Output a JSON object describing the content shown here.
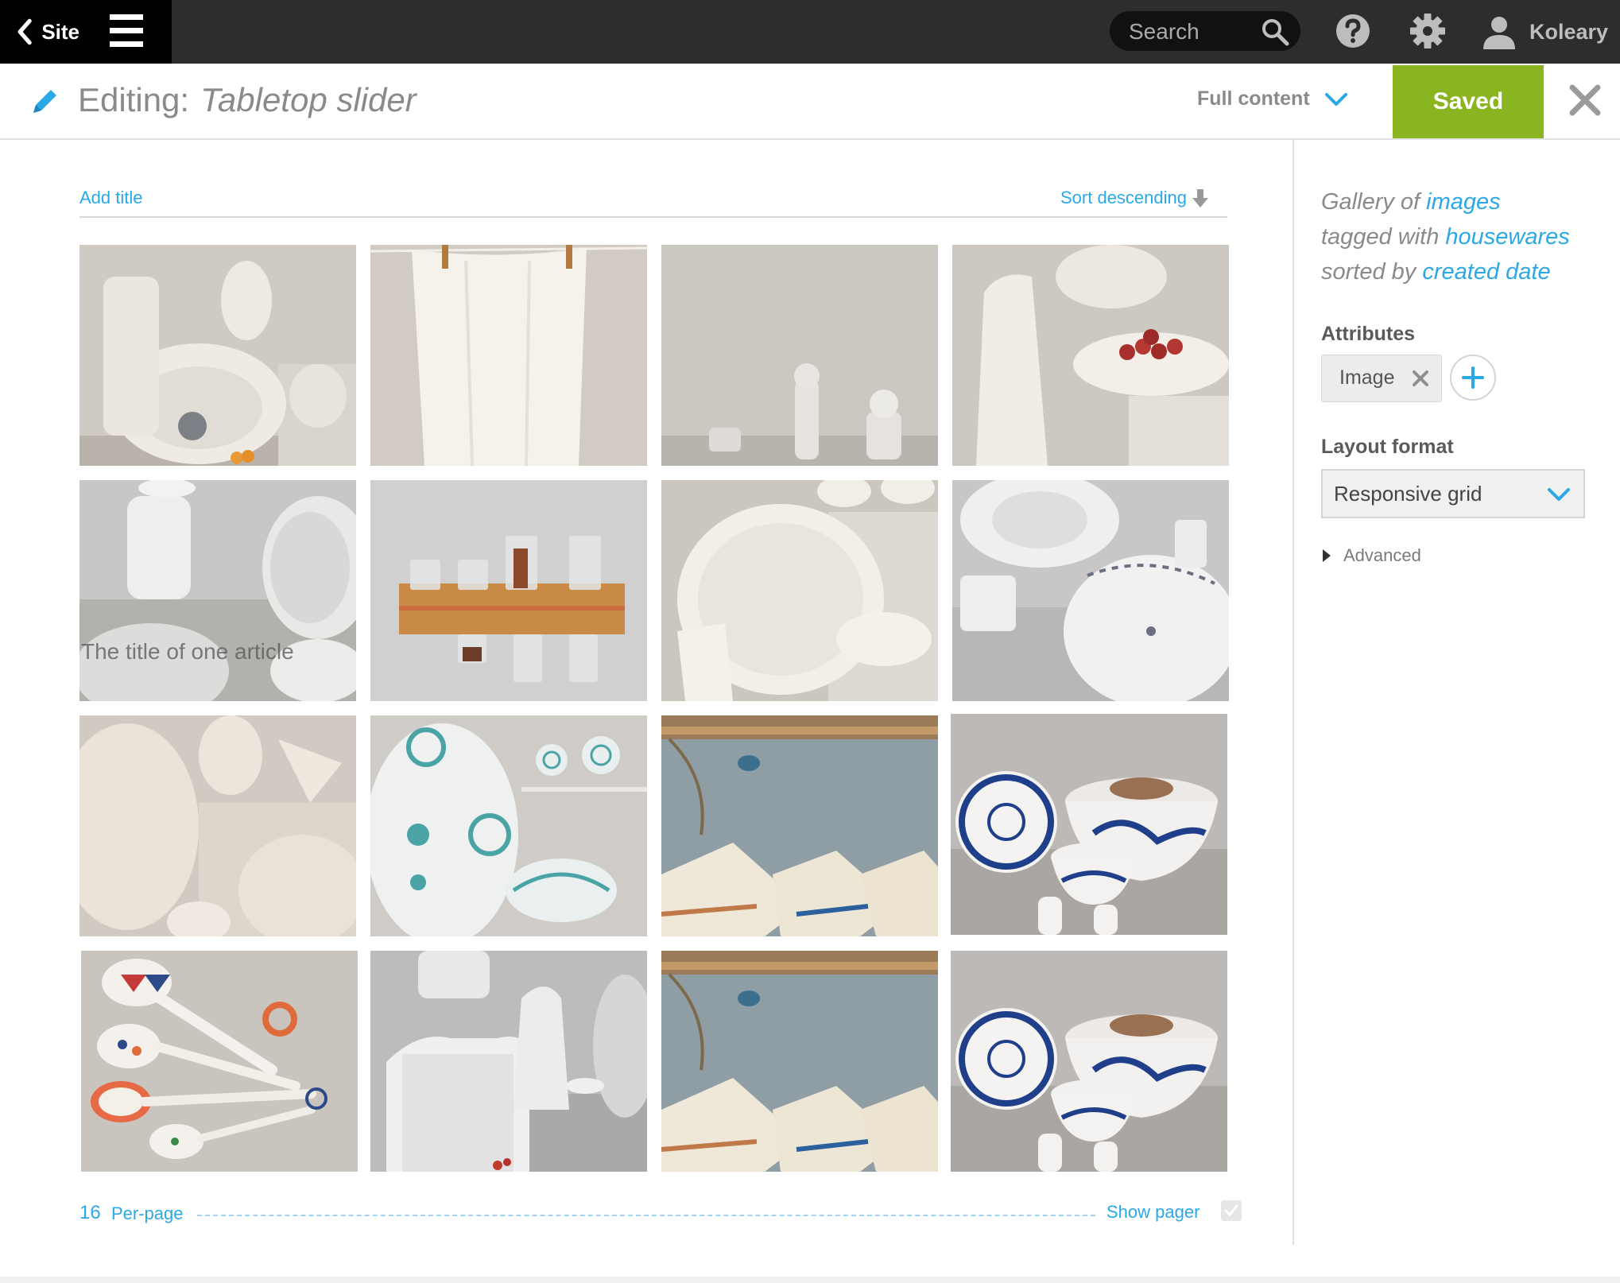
{
  "topbar": {
    "site_label": "Site",
    "search_placeholder": "Search",
    "user_name": "Koleary"
  },
  "editbar": {
    "editing_label": "Editing:",
    "item_name": "Tabletop slider",
    "content_mode": "Full content",
    "saved_label": "Saved"
  },
  "gallery": {
    "add_title": "Add title",
    "sort_label": "Sort descending",
    "overlay_text": "The title of one article",
    "per_page_count": "16",
    "per_page_label": "Per-page",
    "show_pager_label": "Show pager",
    "show_pager_checked": true,
    "tiles": [
      {
        "name": "tile-dishes-grey",
        "theme": "plates"
      },
      {
        "name": "tile-tea-towel",
        "theme": "towel"
      },
      {
        "name": "tile-salt-shakers",
        "theme": "shakers"
      },
      {
        "name": "tile-white-pitcher",
        "theme": "pitcher"
      },
      {
        "name": "tile-coffee-pot",
        "theme": "coffeepot"
      },
      {
        "name": "tile-spice-rack",
        "theme": "spicerack"
      },
      {
        "name": "tile-white-platter",
        "theme": "platter"
      },
      {
        "name": "tile-floral-plates",
        "theme": "floral"
      },
      {
        "name": "tile-lace-platter",
        "theme": "lace"
      },
      {
        "name": "tile-teal-platter",
        "theme": "teal"
      },
      {
        "name": "tile-pot-holders",
        "theme": "potholders"
      },
      {
        "name": "tile-blue-bowls",
        "theme": "bluebowls"
      },
      {
        "name": "tile-measuring-spoons",
        "theme": "spoons"
      },
      {
        "name": "tile-white-tray",
        "theme": "tray"
      },
      {
        "name": "tile-pot-holders-2",
        "theme": "potholders"
      },
      {
        "name": "tile-blue-bowls-2",
        "theme": "bluebowls"
      }
    ]
  },
  "panel": {
    "desc_prefix1": "Gallery of",
    "desc_link1": "images",
    "desc_prefix2": "tagged with",
    "desc_link2": "housewares",
    "desc_prefix3": "sorted by",
    "desc_link3": "created date",
    "attributes_title": "Attributes",
    "attribute_chip": "Image",
    "layout_title": "Layout format",
    "layout_value": "Responsive grid",
    "advanced_label": "Advanced"
  },
  "colors": {
    "accent": "#2ba8e6",
    "saved_green": "#8ab520",
    "topbar": "#2d2d2d"
  }
}
